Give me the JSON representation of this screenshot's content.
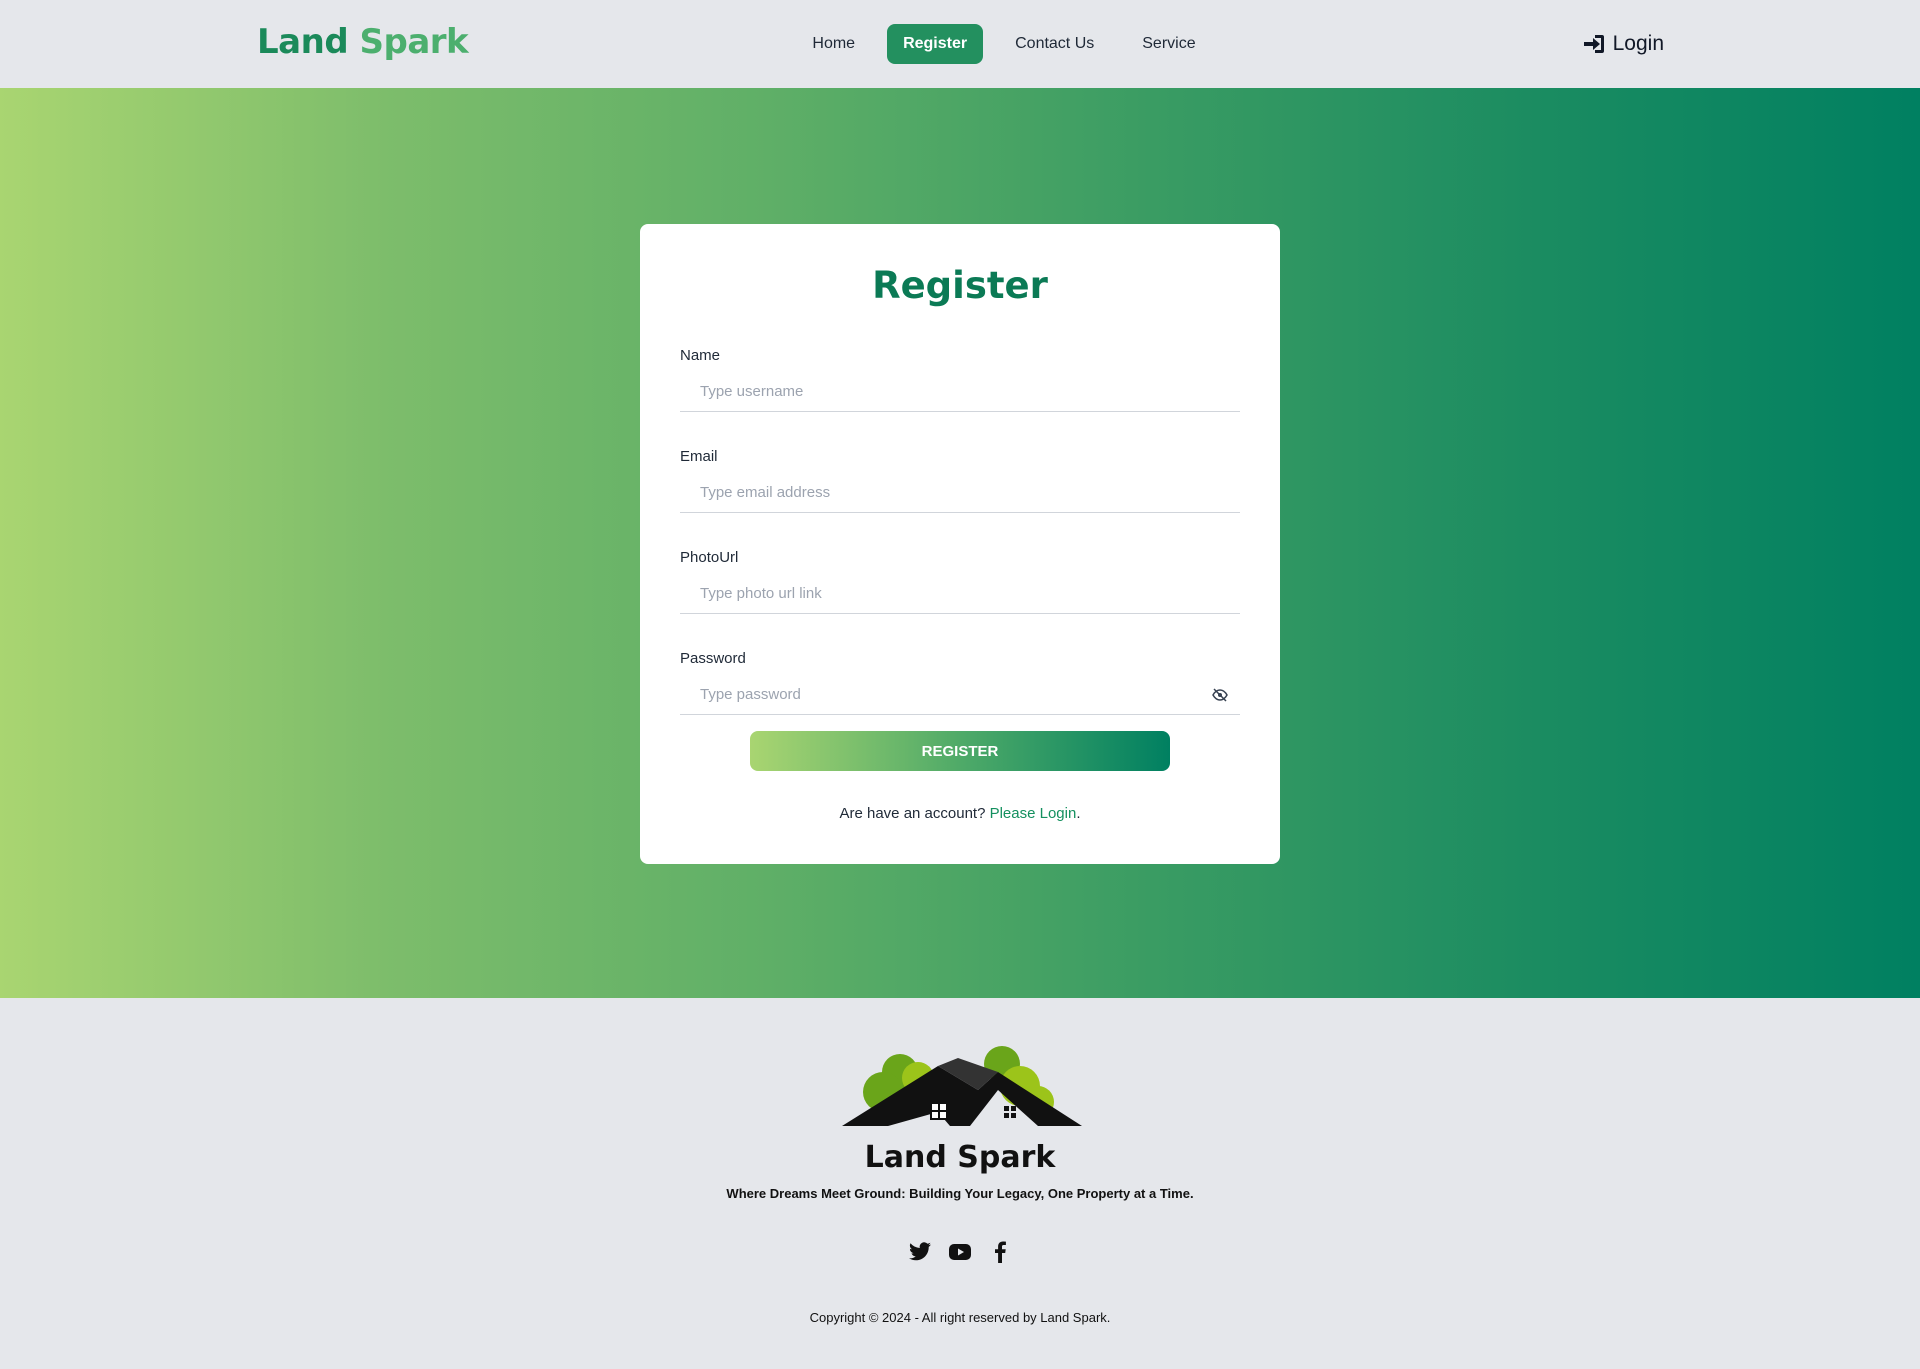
{
  "header": {
    "brand_part1": "Land",
    "brand_part2": "Spark",
    "nav": [
      "Home",
      "Register",
      "Contact Us",
      "Service"
    ],
    "active_nav": "Register",
    "login_label": "Login"
  },
  "form": {
    "title": "Register",
    "fields": [
      {
        "label": "Name",
        "placeholder": "Type username",
        "value": ""
      },
      {
        "label": "Email",
        "placeholder": "Type email address",
        "value": ""
      },
      {
        "label": "PhotoUrl",
        "placeholder": "Type photo url link",
        "value": ""
      },
      {
        "label": "Password",
        "placeholder": "Type password",
        "value": ""
      }
    ],
    "submit_label": "REGISTER",
    "switch_text": "Are have an account?",
    "switch_link": "Please Login",
    "switch_suffix": "."
  },
  "footer": {
    "title": "Land Spark",
    "tagline": "Where Dreams Meet Ground: Building Your Legacy, One Property at a Time.",
    "social_icons": [
      "twitter-icon",
      "youtube-icon",
      "facebook-icon"
    ],
    "copyright": "Copyright © 2024 - All right reserved by Land Spark."
  },
  "colors": {
    "accent": "#23905f",
    "title": "#0b7a55",
    "gradient_start": "#a9d571",
    "gradient_end": "#008061"
  }
}
